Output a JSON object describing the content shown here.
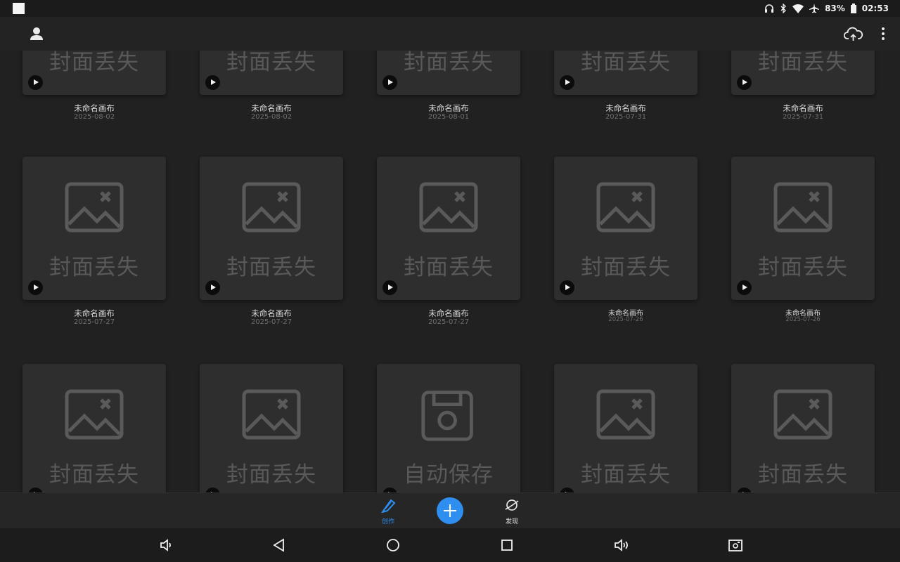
{
  "status_bar": {
    "battery": "83%",
    "time": "02:53"
  },
  "thumbnail_text": {
    "cover_lost": "封面丢失",
    "autosave": "自动保存"
  },
  "rows": [
    {
      "items": [
        {
          "title": "未命名画布",
          "date": "2025-08-02"
        },
        {
          "title": "未命名画布",
          "date": "2025-08-02"
        },
        {
          "title": "未命名画布",
          "date": "2025-08-01"
        },
        {
          "title": "未命名画布",
          "date": "2025-07-31"
        },
        {
          "title": "未命名画布",
          "date": "2025-07-31"
        }
      ]
    },
    {
      "items": [
        {
          "title": "未命名画布",
          "date": "2025-07-27"
        },
        {
          "title": "未命名画布",
          "date": "2025-07-27"
        },
        {
          "title": "未命名画布",
          "date": "2025-07-27"
        },
        {
          "title": "未命名画布",
          "date": "2025-07-26"
        },
        {
          "title": "未命名画布",
          "date": "2025-07-26"
        }
      ]
    }
  ],
  "third_row_covers": [
    "cover_lost",
    "cover_lost",
    "autosave",
    "cover_lost",
    "cover_lost"
  ],
  "bottom_nav": {
    "create_label": "创作",
    "discover_label": "发现"
  },
  "colors": {
    "accent": "#2f8ff0",
    "background": "#212121",
    "card": "#2e2e2e",
    "placeholder": "#595959"
  }
}
